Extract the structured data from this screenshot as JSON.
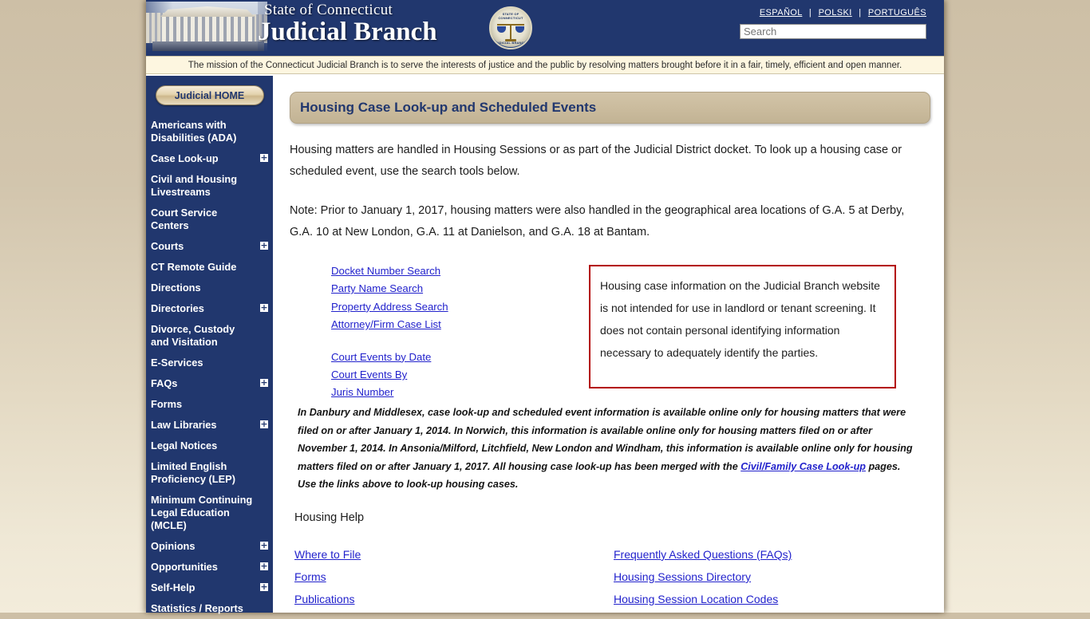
{
  "header": {
    "state_line": "State of Connecticut",
    "branch_line": "Judicial Branch",
    "seal_top_text": "STATE OF CONNECTICUT",
    "seal_bottom_text": "JUDICIAL BRANCH",
    "languages": [
      {
        "label": "ESPAÑOL"
      },
      {
        "label": "POLSKI"
      },
      {
        "label": "PORTUGUÊS"
      }
    ],
    "separator": "|",
    "search_placeholder": "Search",
    "search_value": ""
  },
  "mission": "The mission of the Connecticut Judicial Branch is to serve the interests of justice and the public by resolving matters brought before it in a fair, timely, efficient and open manner.",
  "sidebar": {
    "home_button": "Judicial HOME",
    "expand_glyph": "+",
    "items": [
      {
        "label": "Americans with Disabilities (ADA)",
        "expandable": false
      },
      {
        "label": "Case Look-up",
        "expandable": true
      },
      {
        "label": "Civil and Housing Livestreams",
        "expandable": false
      },
      {
        "label": "Court Service Centers",
        "expandable": false
      },
      {
        "label": "Courts",
        "expandable": true
      },
      {
        "label": "CT Remote Guide",
        "expandable": false
      },
      {
        "label": "Directions",
        "expandable": false
      },
      {
        "label": "Directories",
        "expandable": true
      },
      {
        "label": "Divorce, Custody and Visitation",
        "expandable": false
      },
      {
        "label": "E-Services",
        "expandable": false
      },
      {
        "label": "FAQs",
        "expandable": true
      },
      {
        "label": "Forms",
        "expandable": false
      },
      {
        "label": "Law Libraries",
        "expandable": true
      },
      {
        "label": "Legal Notices",
        "expandable": false
      },
      {
        "label": "Limited English Proficiency (LEP)",
        "expandable": false
      },
      {
        "label": "Minimum Continuing Legal Education (MCLE)",
        "expandable": false
      },
      {
        "label": "Opinions",
        "expandable": true
      },
      {
        "label": "Opportunities",
        "expandable": true
      },
      {
        "label": "Self-Help",
        "expandable": true
      },
      {
        "label": "Statistics / Reports",
        "expandable": false
      }
    ]
  },
  "main": {
    "page_title": "Housing Case Look-up and Scheduled Events",
    "intro_paragraph": "Housing matters are handled in Housing Sessions or as part of the Judicial District docket. To look up a housing case or scheduled event, use the search tools below.",
    "note_paragraph": "Note: Prior to January 1, 2017, housing matters were also handled in the geographical area locations of G.A. 5 at Derby, G.A. 10 at New London, G.A. 11 at Danielson, and G.A. 18 at Bantam.",
    "search_links_group1": [
      {
        "label": "Docket Number Search"
      },
      {
        "label": "Party Name Search"
      },
      {
        "label": "Property Address Search"
      },
      {
        "label": "Attorney/Firm Case List"
      }
    ],
    "search_links_group2": [
      {
        "label": "Court Events by Date"
      },
      {
        "label": "Court Events By Juris Number"
      }
    ],
    "warning_box": {
      "text": "Housing case information on the Judicial Branch website is not intended for use in landlord or tenant screening. It does not contain personal identifying information necessary to adequately identify the parties.",
      "border_color": "#b30000"
    },
    "italic_note": {
      "before_link": "In Danbury and Middlesex, case look-up and scheduled event information is available online only for housing matters that were filed on or after January 1, 2014. In Norwich, this information is available online only for housing matters filed on or after November 1, 2014. In Ansonia/Milford, Litchfield, New London and Windham, this information is available online only for housing matters filed on or after January 1, 2017. All housing case look-up has been merged with the ",
      "link": "Civil/Family Case Look-up",
      "after_link": " pages. Use the links above to look-up housing cases."
    },
    "help_heading": "Housing Help",
    "help_links_left": [
      {
        "label": "Where to File"
      },
      {
        "label": "Forms"
      },
      {
        "label": "Publications"
      }
    ],
    "help_links_right": [
      {
        "label": "Frequently Asked Questions (FAQs)"
      },
      {
        "label": "Housing Sessions Directory"
      },
      {
        "label": "Housing Session Location Codes"
      }
    ]
  },
  "colors": {
    "header_navy": "#21376e",
    "title_band_tan": "#cbbc9e",
    "link_blue": "#2222cc",
    "warning_red": "#b30000",
    "mission_cream": "#fdf6e0"
  }
}
